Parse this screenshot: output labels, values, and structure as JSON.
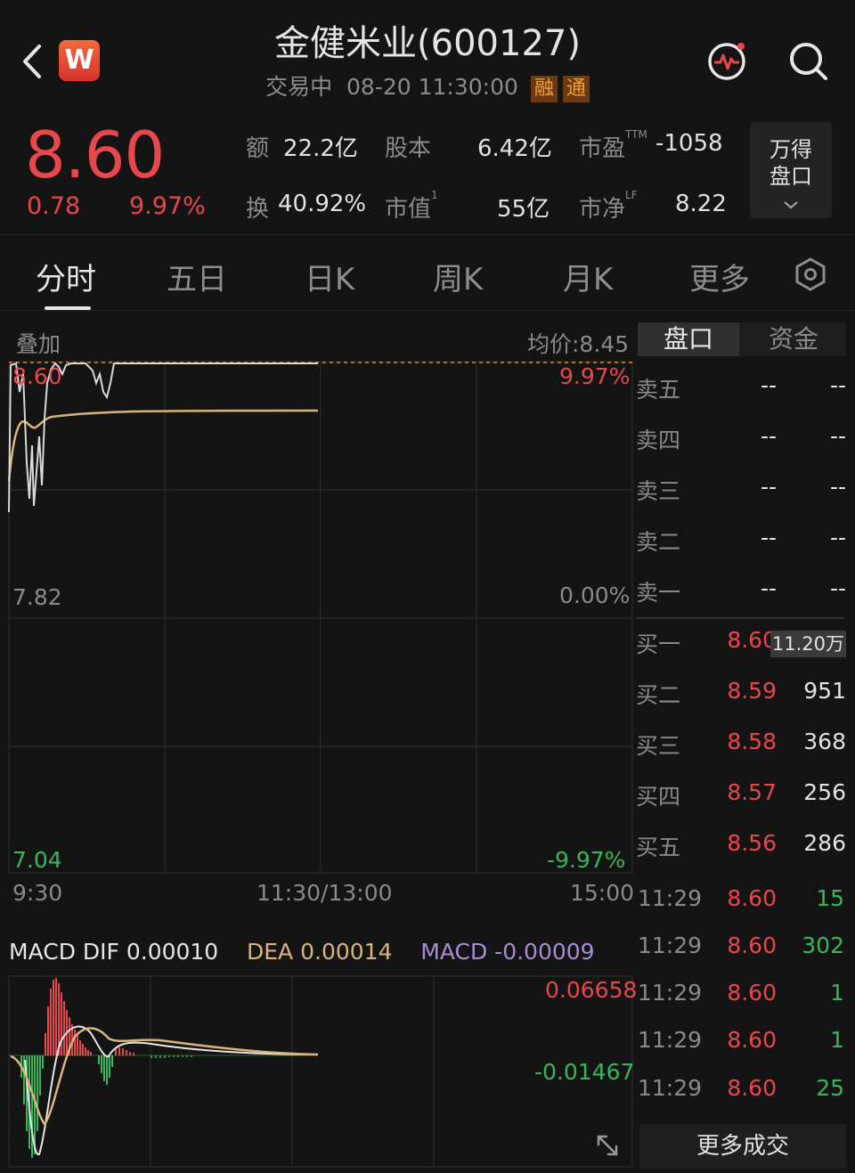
{
  "header": {
    "title": "金健米业(600127)",
    "status": "交易中",
    "datetime": "08-20 11:30:00",
    "tag_margin": "融",
    "tag_connect": "通",
    "logo_letter": "W"
  },
  "quote": {
    "price": "8.60",
    "change": "0.78",
    "change_pct": "9.97%",
    "turnover_amount_label": "额",
    "turnover_amount": "22.2亿",
    "share_capital_label": "股本",
    "share_capital": "6.42亿",
    "pe_label": "市盈",
    "pe_sup": "TTM",
    "pe": "-1058",
    "turnover_rate_label": "换",
    "turnover_rate": "40.92%",
    "market_cap_label": "市值",
    "market_cap_sup": "1",
    "market_cap": "55亿",
    "pb_label": "市净",
    "pb_sup": "LF",
    "pb": "8.22",
    "depth_button_line1": "万得",
    "depth_button_line2": "盘口"
  },
  "tabs": [
    "分时",
    "五日",
    "日K",
    "周K",
    "月K",
    "更多"
  ],
  "chart_labels": {
    "overlay": "叠加",
    "avg_price": "均价:8.45",
    "top_price": "8.60",
    "top_pct": "9.97%",
    "mid_price": "7.82",
    "mid_pct": "0.00%",
    "bottom_price": "7.04",
    "bottom_pct": "-9.97%",
    "time_start": "9:30",
    "time_mid": "11:30/13:00",
    "time_end": "15:00"
  },
  "macd": {
    "dif_label": "MACD DIF 0.00010",
    "dea_label": "DEA 0.00014",
    "macd_label": "MACD -0.00009",
    "top_value": "0.06658",
    "bottom_value": "-0.01467"
  },
  "orderbook": {
    "tab_active": "盘口",
    "tab_fund": "资金",
    "asks": [
      {
        "label": "卖五",
        "price": "--",
        "volume": "--"
      },
      {
        "label": "卖四",
        "price": "--",
        "volume": "--"
      },
      {
        "label": "卖三",
        "price": "--",
        "volume": "--"
      },
      {
        "label": "卖二",
        "price": "--",
        "volume": "--"
      },
      {
        "label": "卖一",
        "price": "--",
        "volume": "--"
      }
    ],
    "bids": [
      {
        "label": "买一",
        "price": "8.60",
        "volume": "11.20万"
      },
      {
        "label": "买二",
        "price": "8.59",
        "volume": "951"
      },
      {
        "label": "买三",
        "price": "8.58",
        "volume": "368"
      },
      {
        "label": "买四",
        "price": "8.57",
        "volume": "256"
      },
      {
        "label": "买五",
        "price": "8.56",
        "volume": "286"
      }
    ]
  },
  "trades": [
    {
      "time": "11:29",
      "price": "8.60",
      "volume": "15"
    },
    {
      "time": "11:29",
      "price": "8.60",
      "volume": "302"
    },
    {
      "time": "11:29",
      "price": "8.60",
      "volume": "1"
    },
    {
      "time": "11:29",
      "price": "8.60",
      "volume": "1"
    },
    {
      "time": "11:29",
      "price": "8.60",
      "volume": "25"
    }
  ],
  "more_trades": "更多成交",
  "colors": {
    "up": "#e8474b",
    "down": "#35b75a",
    "avg_line": "#d9b57a",
    "dea": "#d9b57a",
    "macd": "#a98bd6"
  }
}
